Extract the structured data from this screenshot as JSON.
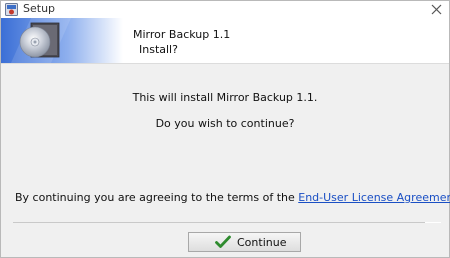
{
  "window": {
    "title": "Setup"
  },
  "header": {
    "title": "Mirror Backup 1.1",
    "subtitle": "Install?"
  },
  "main": {
    "message": "This will install Mirror Backup 1.1.",
    "question": "Do you wish to continue?",
    "terms_prefix": "By continuing you are agreeing to the terms of the ",
    "terms_link": "End-User License Agreement",
    "terms_suffix": "."
  },
  "footer": {
    "continue_label": "Continue"
  },
  "icons": {
    "app": "setup-app-icon",
    "close": "close-icon",
    "banner": "cd-disc-banner",
    "continue": "green-checkmark-icon"
  },
  "colors": {
    "link": "#1a4fc4",
    "content_bg": "#f0f0f0",
    "check_green": "#2e8b2e"
  }
}
